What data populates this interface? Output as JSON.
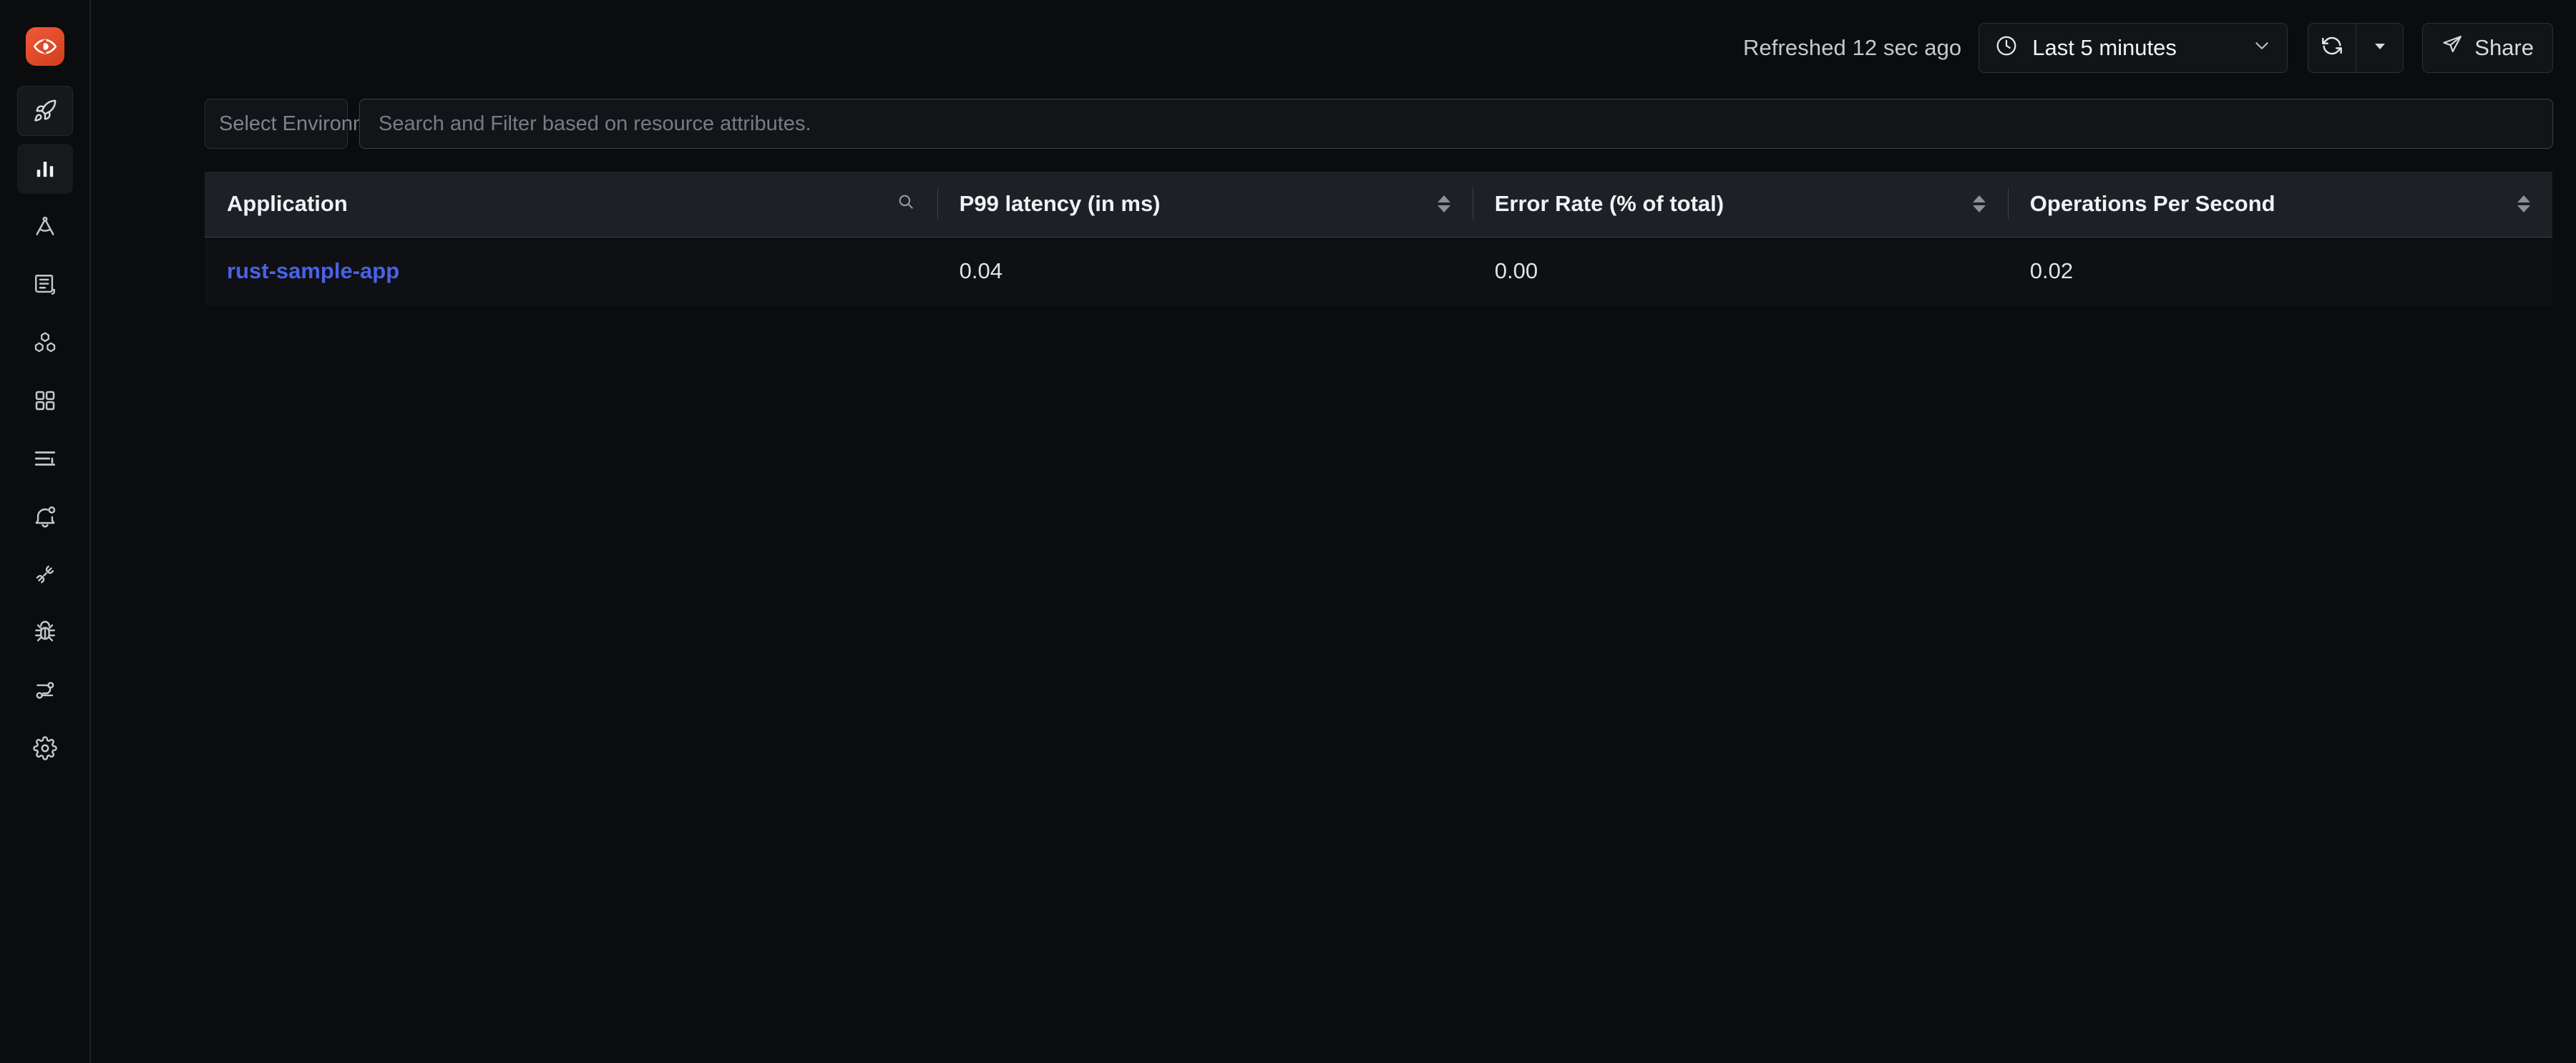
{
  "app": {
    "logo_name": "signoz-eye-logo",
    "brand_color": "#e04a28",
    "accent_color": "#4457d6",
    "link_color": "#4a61e8"
  },
  "sidebar": {
    "items": [
      {
        "icon": "rocket-icon",
        "name": "get-started",
        "active": false,
        "boxed": true
      },
      {
        "icon": "bar-chart-icon",
        "name": "services",
        "active": true,
        "boxed": true
      },
      {
        "icon": "compass-icon",
        "name": "traces",
        "active": false,
        "boxed": false
      },
      {
        "icon": "scroll-icon",
        "name": "logs",
        "active": false,
        "boxed": false
      },
      {
        "icon": "boxes-icon",
        "name": "infrastructure",
        "active": false,
        "boxed": false
      },
      {
        "icon": "grid-icon",
        "name": "dashboards",
        "active": false,
        "boxed": false
      },
      {
        "icon": "list-icon",
        "name": "billing",
        "active": false,
        "boxed": false
      },
      {
        "icon": "bell-icon",
        "name": "alerts",
        "active": false,
        "boxed": false
      },
      {
        "icon": "plug-icon",
        "name": "integrations",
        "active": false,
        "boxed": false
      },
      {
        "icon": "bug-icon",
        "name": "exceptions",
        "active": false,
        "boxed": false
      },
      {
        "icon": "pipeline-icon",
        "name": "pipelines",
        "active": false,
        "boxed": false
      },
      {
        "icon": "gear-icon",
        "name": "settings",
        "active": false,
        "boxed": false
      }
    ]
  },
  "topbar": {
    "refreshed_text": "Refreshed 12 sec ago",
    "time_range": "Last 5 minutes",
    "clock_icon": "clock-icon",
    "chevron_icon": "chevron-down-icon",
    "refresh_icon": "refresh-icon",
    "refresh_dropdown_icon": "caret-down-icon",
    "share_label": "Share",
    "share_icon": "send-icon"
  },
  "filters": {
    "environment_placeholder": "Select Environment/s",
    "environment_value": "",
    "search_placeholder": "Search and Filter based on resource attributes.",
    "search_value": ""
  },
  "table": {
    "columns": [
      {
        "label": "Application",
        "sortable": false,
        "has_search": true,
        "align": "left"
      },
      {
        "label": "P99 latency (in ms)",
        "sortable": true,
        "has_search": false,
        "align": "left"
      },
      {
        "label": "Error Rate (% of total)",
        "sortable": true,
        "has_search": false,
        "align": "left"
      },
      {
        "label": "Operations Per Second",
        "sortable": true,
        "has_search": false,
        "align": "left"
      }
    ],
    "rows": [
      {
        "application": "rust-sample-app",
        "p99_latency": "0.04",
        "error_rate": "0.00",
        "operations_per_second": "0.02"
      }
    ]
  }
}
